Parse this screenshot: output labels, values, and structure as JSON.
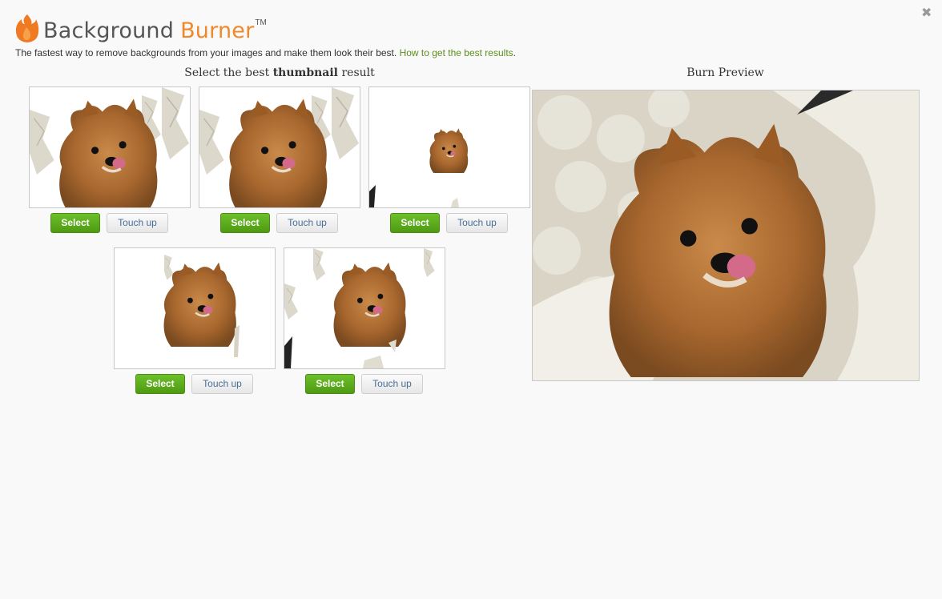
{
  "header": {
    "logo_word1": "Background",
    "logo_word2": "Burner",
    "trademark": "TM",
    "tagline": "The fastest way to remove backgrounds from your images and make them look their best.",
    "tagline_link": "How to get the best results",
    "tagline_end": "."
  },
  "close_label": "✖",
  "thumbnails": {
    "title_pre": "Select the best ",
    "title_bold": "thumbnail",
    "title_post": " result",
    "items": [
      {
        "select_label": "Select",
        "touchup_label": "Touch up"
      },
      {
        "select_label": "Select",
        "touchup_label": "Touch up"
      },
      {
        "select_label": "Select",
        "touchup_label": "Touch up"
      },
      {
        "select_label": "Select",
        "touchup_label": "Touch up"
      },
      {
        "select_label": "Select",
        "touchup_label": "Touch up"
      }
    ]
  },
  "preview": {
    "title": "Burn Preview"
  },
  "colors": {
    "accent": "#f0882a",
    "select_green": "#5aaa1a",
    "link": "#5a8f1c"
  }
}
